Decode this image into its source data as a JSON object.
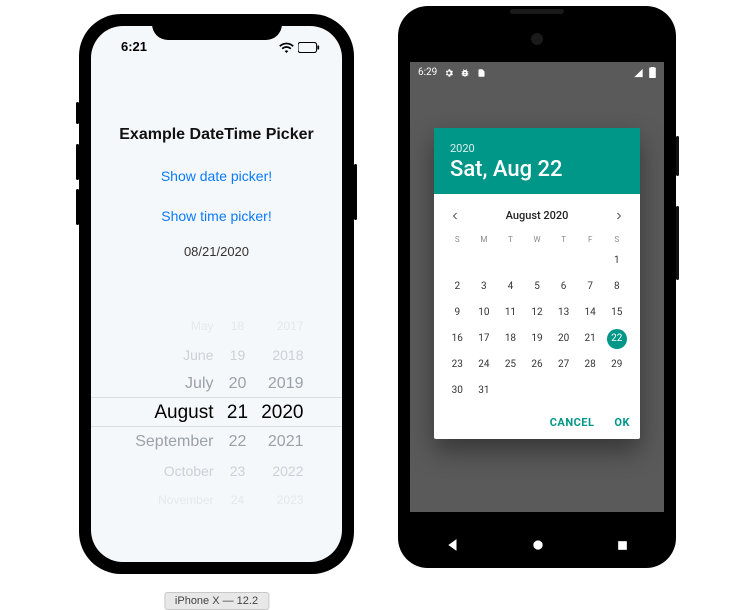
{
  "iphone": {
    "deviceLabel": "iPhone X — 12.2",
    "status": {
      "time": "6:21"
    },
    "title": "Example DateTime Picker",
    "buttons": {
      "showDate": "Show date picker!",
      "showTime": "Show time picker!"
    },
    "currentDate": "08/21/2020",
    "picker": {
      "months": [
        "May",
        "June",
        "July",
        "August",
        "September",
        "October",
        "November"
      ],
      "days": [
        "18",
        "19",
        "20",
        "21",
        "22",
        "23",
        "24"
      ],
      "years": [
        "2017",
        "2018",
        "2019",
        "2020",
        "2021",
        "2022",
        "2023"
      ],
      "selectedIndex": 3
    }
  },
  "android": {
    "status": {
      "time": "6:29"
    },
    "dialog": {
      "year": "2020",
      "headline": "Sat, Aug 22",
      "monthTitle": "August 2020",
      "weekdays": [
        "S",
        "M",
        "T",
        "W",
        "T",
        "F",
        "S"
      ],
      "weeks": [
        [
          "",
          "",
          "",
          "",
          "",
          "",
          "1"
        ],
        [
          "2",
          "3",
          "4",
          "5",
          "6",
          "7",
          "8"
        ],
        [
          "9",
          "10",
          "11",
          "12",
          "13",
          "14",
          "15"
        ],
        [
          "16",
          "17",
          "18",
          "19",
          "20",
          "21",
          "22"
        ],
        [
          "23",
          "24",
          "25",
          "26",
          "27",
          "28",
          "29"
        ],
        [
          "30",
          "31",
          "",
          "",
          "",
          "",
          ""
        ]
      ],
      "selectedDay": "22",
      "actions": {
        "cancel": "CANCEL",
        "ok": "OK"
      }
    }
  }
}
